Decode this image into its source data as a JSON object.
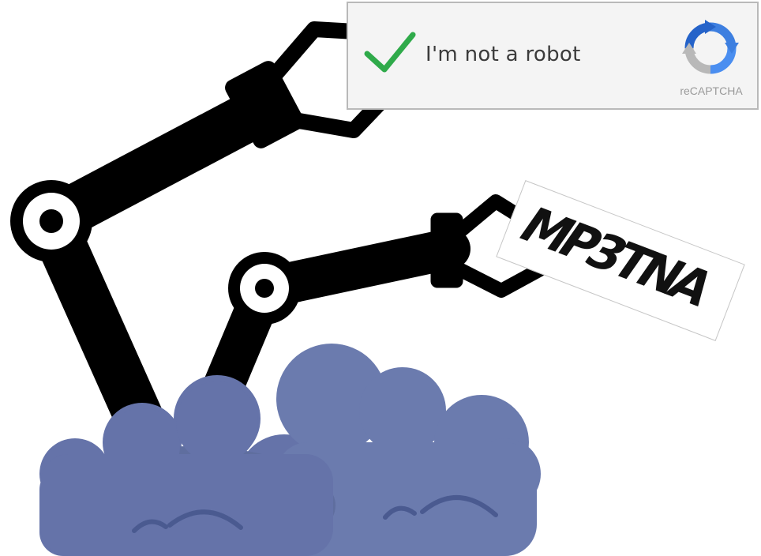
{
  "recaptcha": {
    "checkbox_checked": true,
    "label": "I'm not a robot",
    "brand": "reCAPTCHA",
    "icon": "recaptcha-logo-icon",
    "check_icon": "checkmark-icon",
    "check_color": "#2faa4a"
  },
  "captcha_image": {
    "text": "MP3TNA"
  },
  "illustration": {
    "arm_color": "#000000",
    "cloud_color": "#6b7bae",
    "cloud_shadow_color": "#5f70a3"
  }
}
